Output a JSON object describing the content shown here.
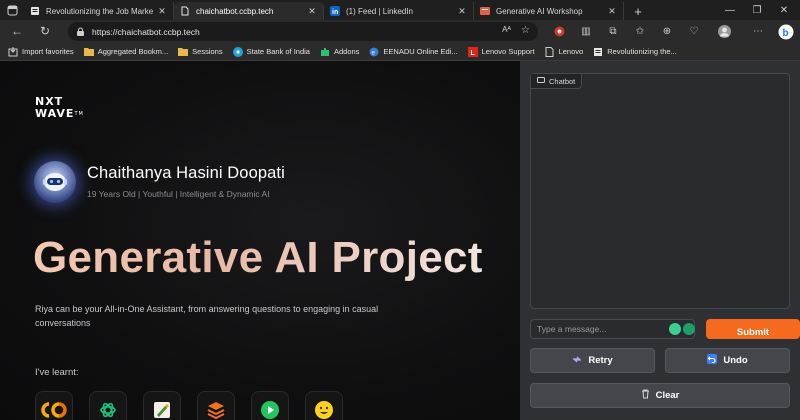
{
  "browser": {
    "tabs": [
      {
        "title": "Revolutionizing the Job Market |",
        "active": false
      },
      {
        "title": "chaichatbot.ccbp.tech",
        "active": true
      },
      {
        "title": "(1) Feed | LinkedIn",
        "active": false
      },
      {
        "title": "Generative AI Workshop",
        "active": false
      }
    ],
    "url": "https://chaichatbot.ccbp.tech",
    "bookmarks": [
      {
        "label": "Import favorites",
        "icon": "import-icon"
      },
      {
        "label": "Aggregated Bookm...",
        "icon": "folder-icon"
      },
      {
        "label": "Sessions",
        "icon": "folder-icon"
      },
      {
        "label": "State Bank of India",
        "icon": "sbi-icon"
      },
      {
        "label": "Addons",
        "icon": "puzzle-icon"
      },
      {
        "label": "EENADU Online Edi...",
        "icon": "eenadu-icon"
      },
      {
        "label": "Lenovo Support",
        "icon": "lenovo-icon"
      },
      {
        "label": "Lenovo",
        "icon": "page-icon"
      },
      {
        "label": "Revolutionizing the...",
        "icon": "page-icon"
      }
    ]
  },
  "hero": {
    "logo_line1": "NXT",
    "logo_line2": "WAVE",
    "logo_tm": "TM",
    "name": "Chaithanya Hasini Doopati",
    "tagline": "19 Years Old | Youthful | Intelligent & Dynamic AI",
    "headline": "Generative AI Project",
    "description": "Riya can be your All-in-One Assistant, from answering questions to engaging in casual conversations",
    "learnt_label": "I've learnt:",
    "tools": [
      "colab-icon",
      "openai-icon",
      "pen-tool-icon",
      "layers-icon",
      "play-icon",
      "huggingface-icon"
    ]
  },
  "chat": {
    "label": "Chatbot",
    "input_placeholder": "Type a message...",
    "submit_label": "Submit",
    "retry_label": "Retry",
    "undo_label": "Undo",
    "clear_label": "Clear"
  },
  "colors": {
    "accent": "#f56a1e",
    "panel_bg": "#2f3033",
    "page_bg": "#0c0c0d"
  }
}
